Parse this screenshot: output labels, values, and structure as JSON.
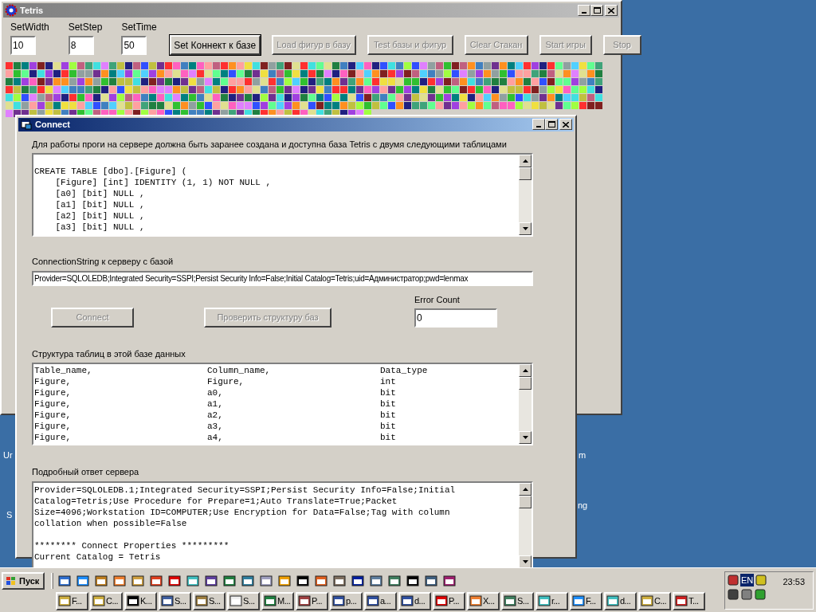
{
  "desktop": {
    "labels": [
      {
        "text": "Ur"
      },
      {
        "text": "S"
      },
      {
        "text": "m"
      },
      {
        "text": "ng"
      }
    ]
  },
  "tetris_window": {
    "title": "Tetris",
    "active": false,
    "fields": [
      {
        "label": "SetWidth",
        "value": "10"
      },
      {
        "label": "SetStep",
        "value": "8"
      },
      {
        "label": "SetTime",
        "value": "50"
      }
    ],
    "buttons": [
      {
        "label": "Set Коннект к базе",
        "disabled": false,
        "default": true
      },
      {
        "label": "Load фигур в базу",
        "disabled": true,
        "default": false
      },
      {
        "label": "Test базы и фигур",
        "disabled": true,
        "default": false
      },
      {
        "label": "Clear Стакан",
        "disabled": true,
        "default": false
      },
      {
        "label": "Start игры",
        "disabled": true,
        "default": false
      },
      {
        "label": "Stop",
        "disabled": true,
        "default": false
      }
    ]
  },
  "connect_dialog": {
    "title": "Connect",
    "active": true,
    "intro": "Для работы проги на сервере должна быть заранее создана и доступна база Tetris с двумя следующими таблицами",
    "schema_lines": [
      "CREATE TABLE [dbo].[Figure] (",
      "    [Figure] [int] IDENTITY (1, 1) NOT NULL ,",
      "    [a0] [bit] NULL ,",
      "    [a1] [bit] NULL ,",
      "    [a2] [bit] NULL ,",
      "    [a3] [bit] NULL ,"
    ],
    "connection_label": "ConnectionString к серверу с базой",
    "connection_string": "Provider=SQLOLEDB;Integrated Security=SSPI;Persist Security Info=False;Initial Catalog=Tetris;uid=Администратор;pwd=lenmax",
    "buttons": [
      {
        "label": "Connect",
        "disabled": true
      },
      {
        "label": "Проверить структуру баз",
        "disabled": true
      }
    ],
    "error_count": {
      "label": "Error Count",
      "value": "0"
    },
    "structure_label": "Структура таблиц в этой базе данных",
    "structure_rows": [
      [
        "Table_name,",
        "Column_name,",
        "Data_type"
      ],
      [
        "Figure,",
        "Figure,",
        "int"
      ],
      [
        "Figure,",
        "a0,",
        "bit"
      ],
      [
        "Figure,",
        "a1,",
        "bit"
      ],
      [
        "Figure,",
        "a2,",
        "bit"
      ],
      [
        "Figure,",
        "a3,",
        "bit"
      ],
      [
        "Figure,",
        "a4,",
        "bit"
      ]
    ],
    "response_label": "Подробный ответ сервера",
    "response_blocks": [
      {
        "lines": [
          "Provider=SQLOLEDB.1;Integrated Security=SSPI;Persist Security Info=False;Initial",
          "Catalog=Tetris;Use Procedure for Prepare=1;Auto Translate=True;Packet",
          "Size=4096;Workstation ID=COMPUTER;Use Encryption for Data=False;Tag with column",
          "collation when possible=False"
        ]
      },
      {
        "lines": [
          "******** Connect Properties *********",
          "Current Catalog = Tetris"
        ]
      }
    ]
  },
  "taskbar": {
    "start": "Пуск",
    "tasks": [
      {
        "label": "F..."
      },
      {
        "label": "C..."
      },
      {
        "label": "K..."
      },
      {
        "label": "S..."
      },
      {
        "label": "S..."
      },
      {
        "label": "S..."
      },
      {
        "label": "M..."
      },
      {
        "label": "P..."
      },
      {
        "label": "p..."
      },
      {
        "label": "a..."
      },
      {
        "label": "d..."
      },
      {
        "label": "P..."
      },
      {
        "label": "X..."
      },
      {
        "label": "S..."
      },
      {
        "label": "r..."
      },
      {
        "label": "F..."
      },
      {
        "label": "d..."
      },
      {
        "label": "C..."
      },
      {
        "label": "T..."
      }
    ],
    "tray": {
      "language": "EN",
      "clock": "23:53"
    }
  }
}
